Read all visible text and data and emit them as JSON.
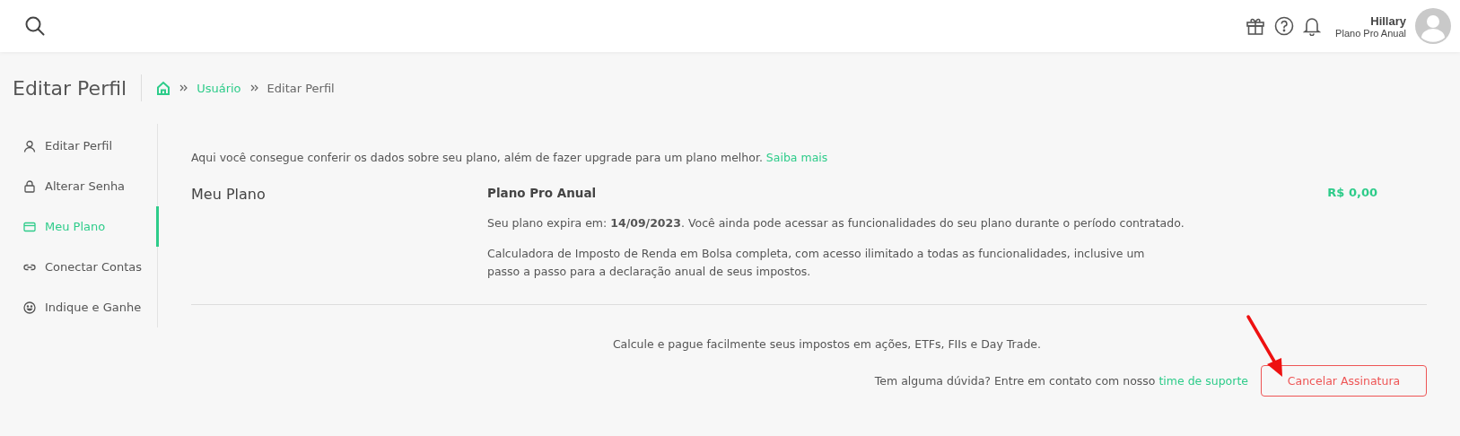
{
  "header": {
    "user_name": "Hillary",
    "user_plan": "Plano Pro Anual"
  },
  "page_title": "Editar Perfil",
  "breadcrumb": [
    {
      "label": "Usuário",
      "kind": "link"
    },
    {
      "label": "Editar Perfil",
      "kind": "current"
    }
  ],
  "sidebar": {
    "items": [
      {
        "label": "Editar Perfil",
        "kind": "user",
        "selected": false
      },
      {
        "label": "Alterar Senha",
        "kind": "lock",
        "selected": false
      },
      {
        "label": "Meu Plano",
        "kind": "card",
        "selected": true
      },
      {
        "label": "Conectar Contas",
        "kind": "link",
        "selected": false
      },
      {
        "label": "Indique e Ganhe",
        "kind": "smile",
        "selected": false
      }
    ]
  },
  "intro": {
    "text": "Aqui você consegue conferir os dados sobre seu plano, além de fazer upgrade para um plano melhor.",
    "link": "Saiba mais"
  },
  "plan": {
    "section_title": "Meu Plano",
    "name": "Plano Pro Anual",
    "price": "R$ 0,00",
    "expiry": "Seu plano expira em: **14/09/2023**. Você ainda pode acessar as funcionalidades do seu plano durante o período contratado.",
    "description": "Calculadora de Imposto de Renda em Bolsa completa, com acesso ilimitado a todas as funcionalidades, inclusive um passo a passo para a declaração anual de seus impostos."
  },
  "footer": {
    "tagline": "Calcule e pague facilmente seus impostos em ações, ETFs, FIIs e Day Trade.",
    "contact_text": "Tem alguma dúvida? Entre em contato com nosso",
    "contact_link": "time de suporte",
    "cancel_button": "Cancelar Assinatura"
  }
}
